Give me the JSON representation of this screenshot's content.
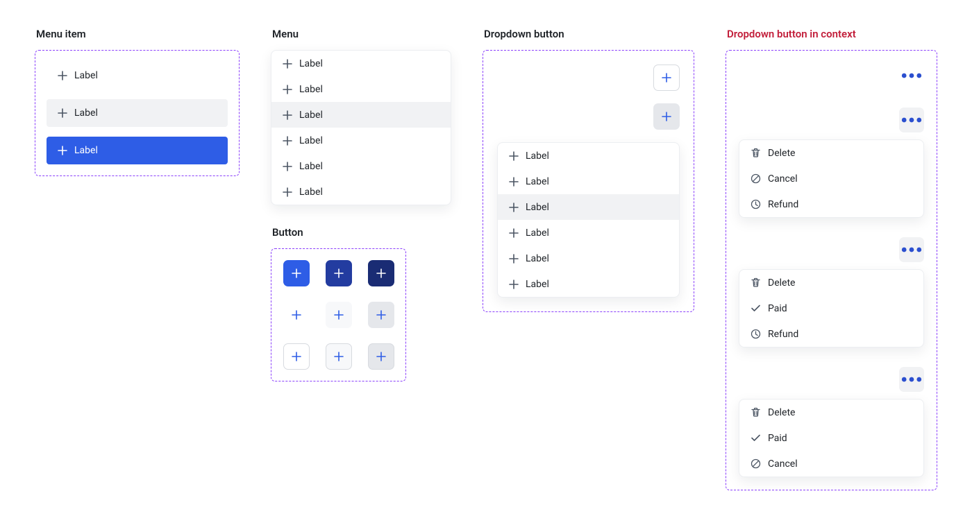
{
  "sections": {
    "menu_item": "Menu item",
    "menu": "Menu",
    "button": "Button",
    "dropdown": "Dropdown button",
    "dropdown_ctx": "Dropdown button in context"
  },
  "menu_item_states": [
    {
      "label": "Label",
      "state": "default"
    },
    {
      "label": "Label",
      "state": "hover"
    },
    {
      "label": "Label",
      "state": "active"
    }
  ],
  "menu_items": [
    {
      "label": "Label"
    },
    {
      "label": "Label"
    },
    {
      "label": "Label"
    },
    {
      "label": "Label"
    },
    {
      "label": "Label"
    },
    {
      "label": "Label"
    }
  ],
  "menu_hover_index": 2,
  "dropdown_menu_items": [
    {
      "label": "Label"
    },
    {
      "label": "Label"
    },
    {
      "label": "Label"
    },
    {
      "label": "Label"
    },
    {
      "label": "Label"
    },
    {
      "label": "Label"
    }
  ],
  "dropdown_hover_index": 2,
  "context_menus": [
    {
      "items": [
        {
          "icon": "trash",
          "label": "Delete"
        },
        {
          "icon": "cancel",
          "label": "Cancel"
        },
        {
          "icon": "clock",
          "label": "Refund"
        }
      ]
    },
    {
      "items": [
        {
          "icon": "trash",
          "label": "Delete"
        },
        {
          "icon": "check",
          "label": "Paid"
        },
        {
          "icon": "clock",
          "label": "Refund"
        }
      ]
    },
    {
      "items": [
        {
          "icon": "trash",
          "label": "Delete"
        },
        {
          "icon": "check",
          "label": "Paid"
        },
        {
          "icon": "cancel",
          "label": "Cancel"
        }
      ]
    }
  ],
  "button_variants": [
    "pri-a",
    "pri-b",
    "pri-c",
    "sec-a",
    "sec-b",
    "sec-c",
    "out-a",
    "out-b",
    "out-c"
  ]
}
